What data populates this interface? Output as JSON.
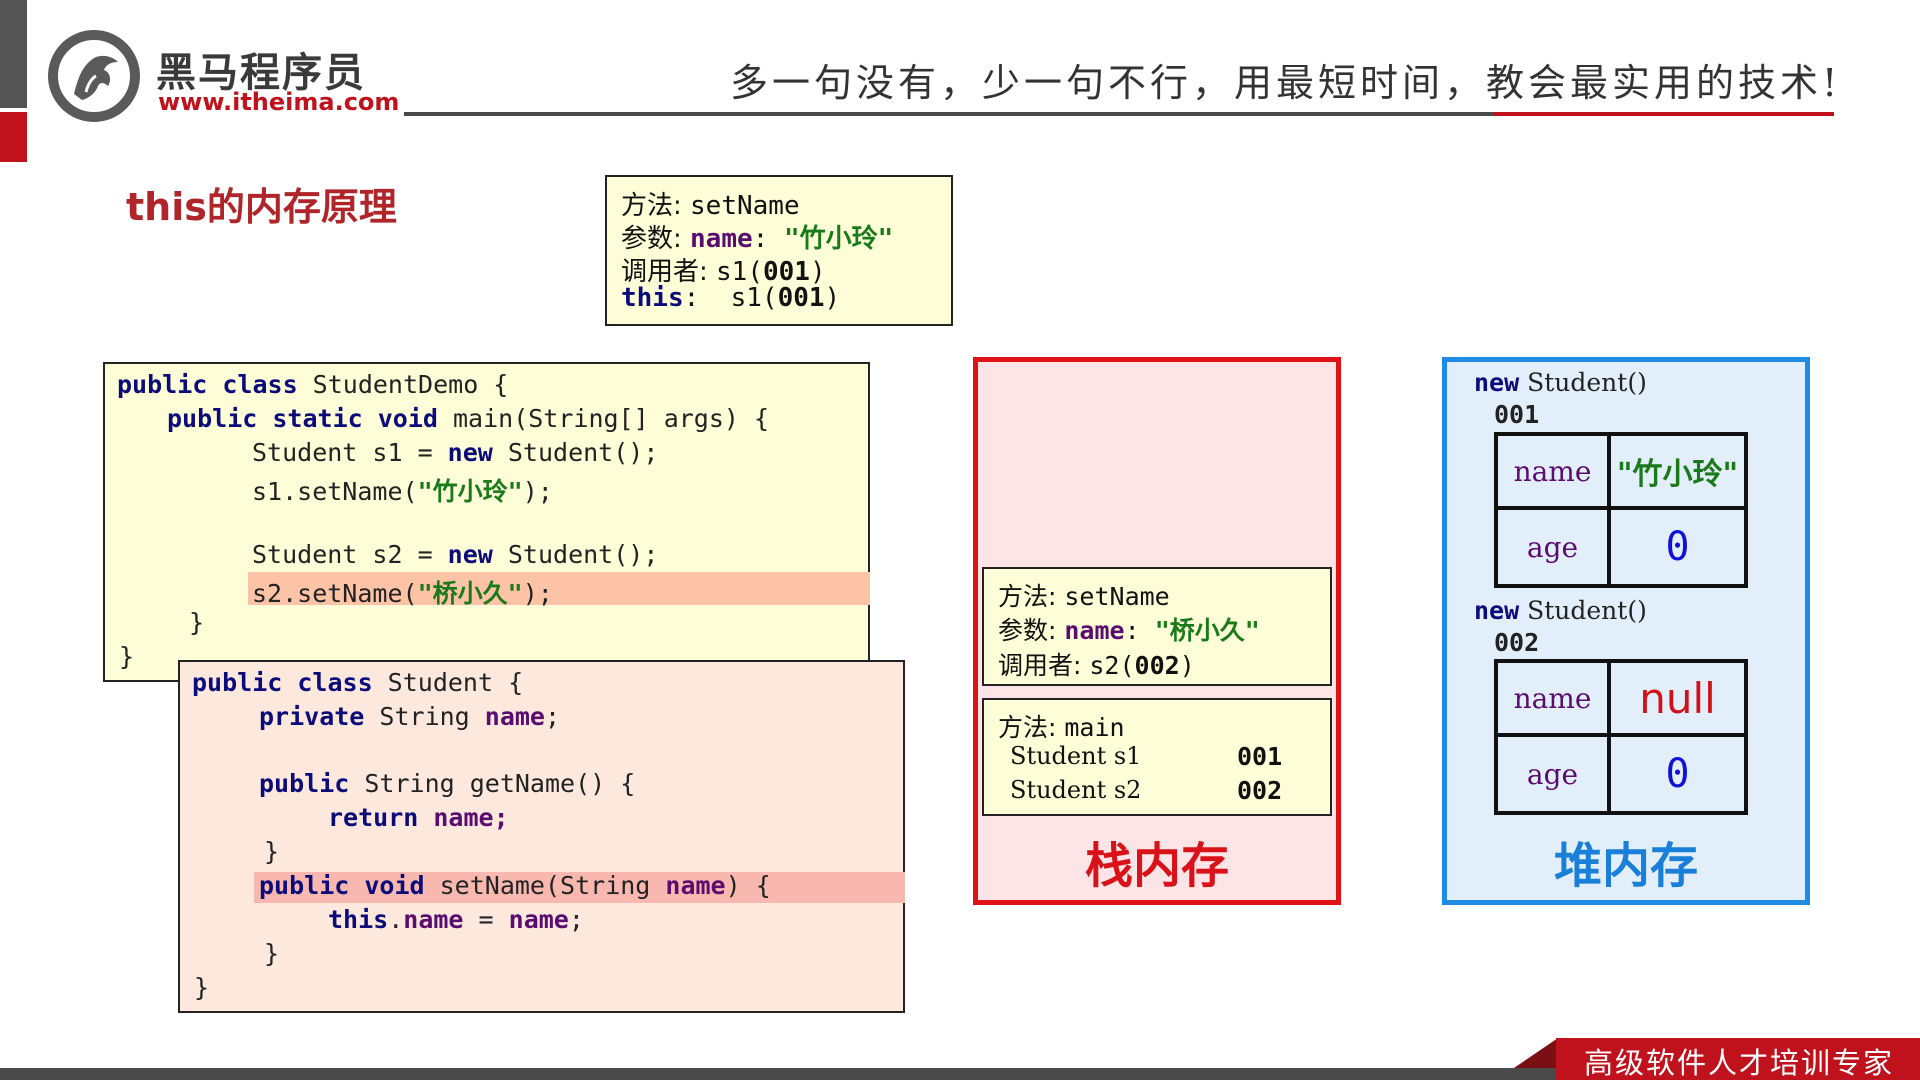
{
  "header": {
    "logo_title": "黑马程序员",
    "logo_url": "www.itheima.com",
    "slogan": "多一句没有，少一句不行，用最短时间，教会最实用的技术!"
  },
  "title": "this的内存原理",
  "callout": {
    "method_label": "方法: ",
    "method_value": "setName",
    "param_label": "参数: ",
    "param_name": "name",
    "param_sep": ": ",
    "param_value": "\"竹小玲\"",
    "caller_label": "调用者: ",
    "caller_value": "s1(",
    "caller_id": "001",
    "this_label": "this",
    "this_sep": ":  ",
    "this_value": "s1(",
    "this_id": "001",
    "close": ")"
  },
  "code_main": {
    "l1_kw": "public class",
    "l1_rest": " StudentDemo {",
    "l2_kw": "public static void",
    "l2_rest": " main(String[] args) {",
    "l3_a": "Student s1 = ",
    "l3_kw": "new",
    "l3_b": " Student();",
    "l4_a": "s1.setName(",
    "l4_str": "\"竹小玲\"",
    "l4_b": ");",
    "l5_a": "Student s2 = ",
    "l5_kw": "new",
    "l5_b": " Student();",
    "l6_a": "s2.setName(",
    "l6_str": "\"桥小久\"",
    "l6_b": ");",
    "brace": "}"
  },
  "code_student": {
    "l1_kw": "public class",
    "l1_rest": " Student {",
    "l2_kw": "private",
    "l2_mid": " String ",
    "l2_fld": "name",
    "l2_end": ";",
    "l3_kw": "public",
    "l3_rest": " String getName() {",
    "l4_kw": "return",
    "l4_fld": " name",
    "l4_end": ";",
    "l5_kw": "public void",
    "l5_mid": " setName(String ",
    "l5_fld": "name",
    "l5_end": ") {",
    "l6_kw": "this",
    "l6_dot": ".",
    "l6_fld": "name",
    "l6_eq": " = ",
    "l6_fld2": "name",
    "l6_end": ";",
    "brace": "}"
  },
  "stack": {
    "label": "栈内存",
    "frame_setname": {
      "method_label": "方法: ",
      "method_value": "setName",
      "param_label": "参数: ",
      "param_name": "name",
      "param_sep": ": ",
      "param_value": "\"桥小久\"",
      "caller_label": "调用者: ",
      "caller_value": "s2(",
      "caller_id": "002",
      "close": ")"
    },
    "frame_main": {
      "method_label": "方法: ",
      "method_value": "main",
      "var1_name": "Student s1",
      "var1_value": "001",
      "var2_name": "Student s2",
      "var2_value": "002"
    }
  },
  "heap": {
    "label": "堆内存",
    "objects": [
      {
        "new_kw": "new",
        "caption": " Student()",
        "address": "001",
        "name_label": "name",
        "name_value": "\"竹小玲\"",
        "age_label": "age",
        "age_value": "0"
      },
      {
        "new_kw": "new",
        "caption": " Student()",
        "address": "002",
        "name_label": "name",
        "name_value": "null",
        "age_label": "age",
        "age_value": "0"
      }
    ]
  },
  "footer": {
    "text": "高级软件人才培训专家"
  },
  "colors": {
    "brand_red": "#c0121c",
    "stack_border": "#e01218",
    "heap_border": "#1f8be4",
    "keyword": "#0b0b7a",
    "string": "#1a7a1a",
    "field": "#5a0d6e"
  }
}
